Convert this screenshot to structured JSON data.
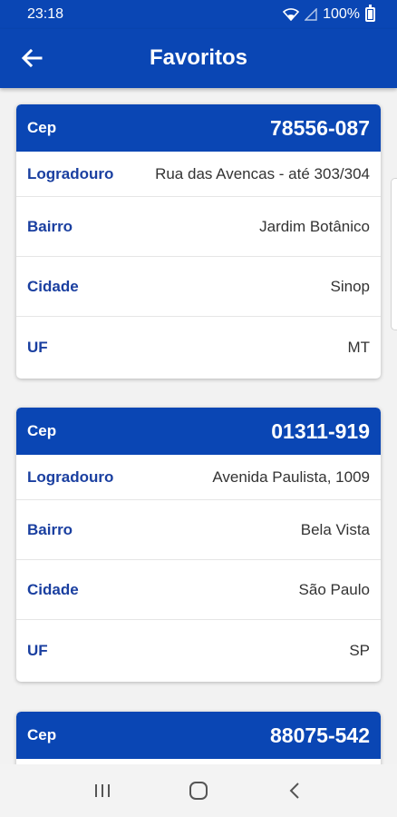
{
  "status_bar": {
    "time": "23:18",
    "battery": "100%"
  },
  "app_bar": {
    "title": "Favoritos"
  },
  "cards": [
    {
      "header_label": "Cep",
      "cep": "78556-087",
      "rows": [
        {
          "label": "Logradouro",
          "value": "Rua das Avencas - até 303/304"
        },
        {
          "label": "Bairro",
          "value": "Jardim Botânico"
        },
        {
          "label": "Cidade",
          "value": "Sinop"
        },
        {
          "label": "UF",
          "value": "MT"
        }
      ]
    },
    {
      "header_label": "Cep",
      "cep": "01311-919",
      "rows": [
        {
          "label": "Logradouro",
          "value": "Avenida Paulista, 1009"
        },
        {
          "label": "Bairro",
          "value": "Bela Vista"
        },
        {
          "label": "Cidade",
          "value": "São Paulo"
        },
        {
          "label": "UF",
          "value": "SP"
        }
      ]
    },
    {
      "header_label": "Cep",
      "cep": "88075-542",
      "rows": []
    }
  ],
  "colors": {
    "primary": "#0a46b4",
    "label": "#1a3fa0"
  },
  "icons": {
    "back": "arrow-left-icon",
    "recents": "recents-icon",
    "home": "home-icon",
    "nav_back": "nav-back-icon"
  }
}
